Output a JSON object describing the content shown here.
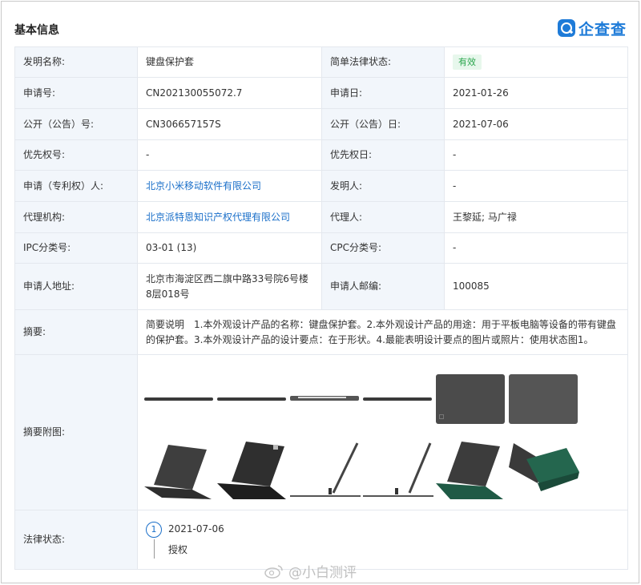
{
  "header": {
    "title": "基本信息",
    "logo_text": "企查查"
  },
  "rows": [
    {
      "l1": "发明名称:",
      "v1": "键盘保护套",
      "l2": "简单法律状态:",
      "v2": "有效"
    },
    {
      "l1": "申请号:",
      "v1": "CN202130055072.7",
      "l2": "申请日:",
      "v2": "2021-01-26"
    },
    {
      "l1": "公开（公告）号:",
      "v1": "CN306657157S",
      "l2": "公开（公告）日:",
      "v2": "2021-07-06"
    },
    {
      "l1": "优先权号:",
      "v1": "-",
      "l2": "优先权日:",
      "v2": "-"
    },
    {
      "l1": "申请（专利权）人:",
      "v1": "北京小米移动软件有限公司",
      "l2": "发明人:",
      "v2": "-"
    },
    {
      "l1": "代理机构:",
      "v1": "北京派特恩知识产权代理有限公司",
      "l2": "代理人:",
      "v2": "王黎延; 马广禄"
    },
    {
      "l1": "IPC分类号:",
      "v1": "03-01 (13)",
      "l2": "CPC分类号:",
      "v2": "-"
    },
    {
      "l1": "申请人地址:",
      "v1": "北京市海淀区西二旗中路33号院6号楼8层018号",
      "l2": "申请人邮编:",
      "v2": "100085"
    }
  ],
  "abstract": {
    "label": "摘要:",
    "text": "简要说明　1.本外观设计产品的名称：键盘保护套。2.本外观设计产品的用途：用于平板电脑等设备的带有键盘的保护套。3.本外观设计产品的设计要点：在于形状。4.最能表明设计要点的图片或照片：使用状态图1。"
  },
  "figures": {
    "label": "摘要附图:"
  },
  "legal": {
    "label": "法律状态:",
    "steps": [
      {
        "index": "1",
        "date": "2021-07-06",
        "status": "授权"
      }
    ]
  },
  "watermark": {
    "text": "@小白测评"
  },
  "colors": {
    "link": "#1a6fc9",
    "badge_bg": "#e7f7ec",
    "badge_fg": "#2aa64d",
    "label_bg": "#f2f6fb",
    "logo": "#1e7bd8"
  }
}
